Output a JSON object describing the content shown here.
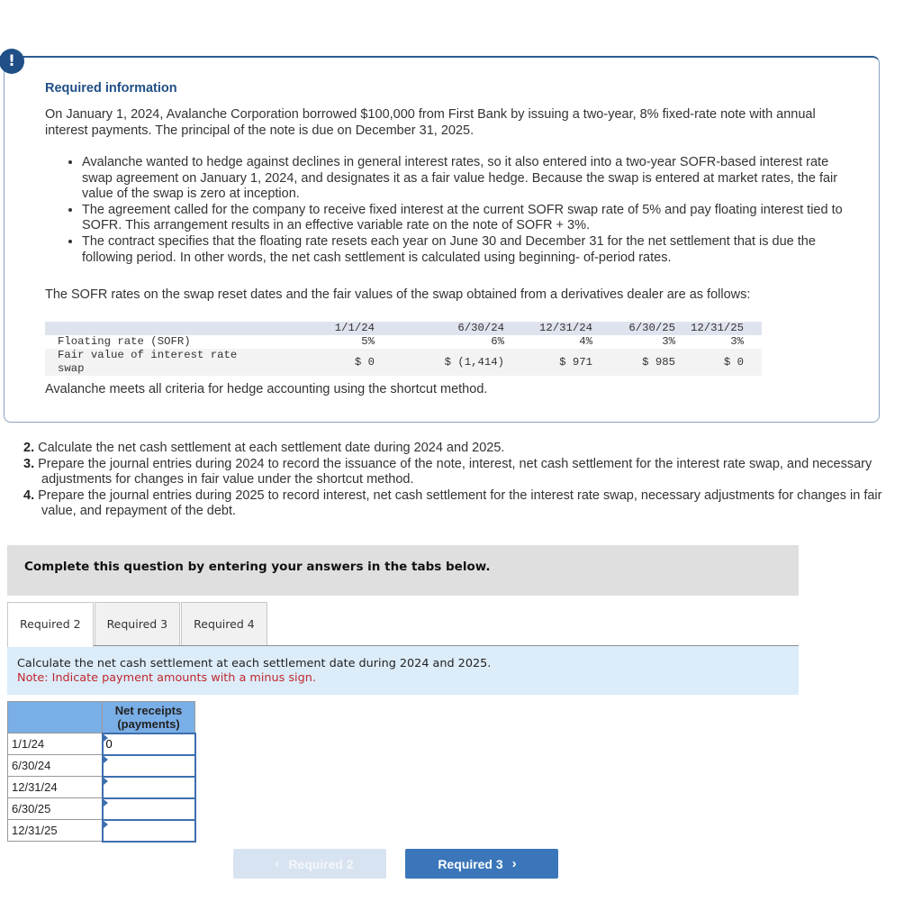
{
  "info": {
    "badge_icon": "exclamation",
    "title": "Required information",
    "intro": "On January 1, 2024, Avalanche Corporation borrowed $100,000 from First Bank by issuing a two-year, 8% fixed-rate note with annual interest payments. The principal of the note is due on December 31, 2025.",
    "bullets": [
      "Avalanche wanted to hedge against declines in general interest rates, so it also entered into a two-year SOFR-based interest rate swap agreement on January 1, 2024, and designates it as a fair value hedge. Because the swap is entered at market rates, the fair value of the swap is zero at inception.",
      "The agreement called for the company to receive fixed interest at the current SOFR swap rate of 5% and pay floating interest tied to SOFR. This arrangement results in an effective variable rate on the note of SOFR + 3%.",
      "The contract specifies that the floating rate resets each year on June 30 and December 31 for the net settlement that is due the following period. In other words, the net cash settlement is calculated using beginning- of-period rates."
    ],
    "sofr_intro": "The SOFR rates on the swap reset dates and the fair values of the swap obtained from a derivatives dealer are as follows:",
    "rates_table": {
      "dates": [
        "1/1/24",
        "6/30/24",
        "12/31/24",
        "6/30/25",
        "12/31/25"
      ],
      "rows": [
        {
          "label": "Floating rate (SOFR)",
          "values": [
            "5%",
            "6%",
            "4%",
            "3%",
            "3%"
          ]
        },
        {
          "label": "Fair value of interest rate swap",
          "values": [
            "$ 0",
            "$ (1,414)",
            "$ 971",
            "$ 985",
            "$ 0"
          ]
        }
      ]
    },
    "criteria": "Avalanche meets all criteria for hedge accounting using the shortcut method."
  },
  "questions": [
    {
      "num": "2.",
      "text": "Calculate the net cash settlement at each settlement date during 2024 and 2025."
    },
    {
      "num": "3.",
      "text": "Prepare the journal entries during 2024 to record the issuance of the note, interest, net cash settlement for the interest rate swap, and necessary adjustments for changes in fair value under the shortcut method."
    },
    {
      "num": "4.",
      "text": "Prepare the journal entries during 2025 to record interest, net cash settlement for the interest rate swap, necessary adjustments for changes in fair value, and repayment of the debt."
    }
  ],
  "banner": "Complete this question by entering your answers in the tabs below.",
  "tabs": [
    {
      "label": "Required 2",
      "active": true
    },
    {
      "label": "Required 3",
      "active": false
    },
    {
      "label": "Required 4",
      "active": false
    }
  ],
  "instructions": {
    "main": "Calculate the net cash settlement at each settlement date during 2024 and 2025.",
    "note": "Note: Indicate payment amounts with a minus sign."
  },
  "answer_table": {
    "header": "Net receipts (payments)",
    "rows": [
      {
        "date": "1/1/24",
        "value": "0"
      },
      {
        "date": "6/30/24",
        "value": ""
      },
      {
        "date": "12/31/24",
        "value": ""
      },
      {
        "date": "6/30/25",
        "value": ""
      },
      {
        "date": "12/31/25",
        "value": ""
      }
    ]
  },
  "nav": {
    "prev_label": "Required 2",
    "next_label": "Required 3",
    "prev_enabled": false
  },
  "colors": {
    "accent_blue": "#1f4f86",
    "next_button": "#3a76b9",
    "prev_button_disabled": "#d8e3f1",
    "note_red": "#c0282d",
    "table_header_blue": "#7aaee6",
    "instructions_bg": "#dcecf9"
  }
}
